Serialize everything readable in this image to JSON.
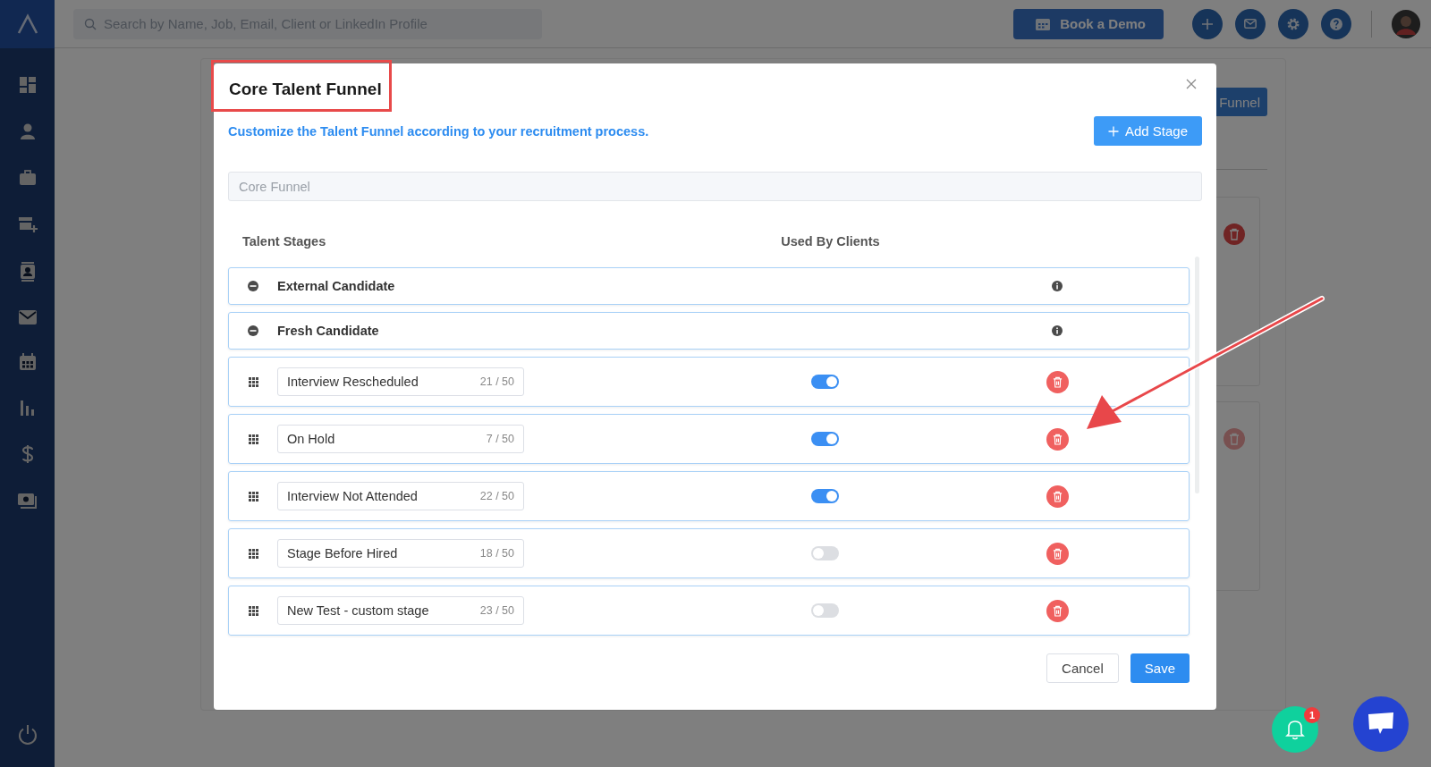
{
  "topbar": {
    "search": {
      "placeholder": "Search by Name, Job, Email, Client or LinkedIn Profile"
    },
    "demo_button": "Book a Demo"
  },
  "background": {
    "button_label": "Funnel"
  },
  "modal": {
    "title": "Core Talent Funnel",
    "subtitle": "Customize the Talent Funnel according to your recruitment process.",
    "add_button": "Add Stage",
    "funnel_name": {
      "value": "Core Funnel"
    },
    "columns": [
      "Talent Stages",
      "Used By Clients"
    ],
    "stages": [
      {
        "kind": "fixed",
        "name": "External Candidate"
      },
      {
        "kind": "fixed",
        "name": "Fresh Candidate"
      },
      {
        "kind": "custom",
        "name": "Interview Rescheduled",
        "counter": "21 / 50",
        "used_by_clients": true
      },
      {
        "kind": "custom",
        "name": "On Hold",
        "counter": "7 / 50",
        "used_by_clients": true
      },
      {
        "kind": "custom",
        "name": "Interview Not Attended",
        "counter": "22 / 50",
        "used_by_clients": true
      },
      {
        "kind": "custom",
        "name": "Stage Before Hired",
        "counter": "18 / 50",
        "used_by_clients": false
      },
      {
        "kind": "custom",
        "name": "New Test - custom stage",
        "counter": "23 / 50",
        "used_by_clients": false
      }
    ],
    "buttons": {
      "cancel": "Cancel",
      "save": "Save"
    }
  },
  "notifications": {
    "badge": "1"
  }
}
